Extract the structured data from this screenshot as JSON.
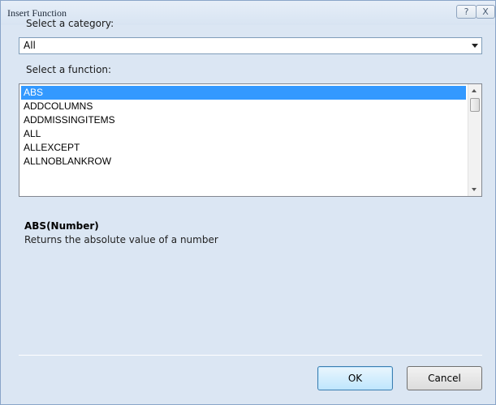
{
  "window": {
    "title": "Insert Function",
    "help_glyph": "?",
    "close_glyph": "X"
  },
  "category": {
    "label": "Select a category:",
    "selected": "All"
  },
  "functions": {
    "label": "Select a function:",
    "items": [
      "ABS",
      "ADDCOLUMNS",
      "ADDMISSINGITEMS",
      "ALL",
      "ALLEXCEPT",
      "ALLNOBLANKROW"
    ],
    "selected_index": 0
  },
  "description": {
    "signature": "ABS(Number)",
    "text": "Returns the absolute value of a number"
  },
  "buttons": {
    "ok": "OK",
    "cancel": "Cancel"
  },
  "colors": {
    "selection": "#3399ff",
    "titlebar": "#dbe6f3"
  }
}
